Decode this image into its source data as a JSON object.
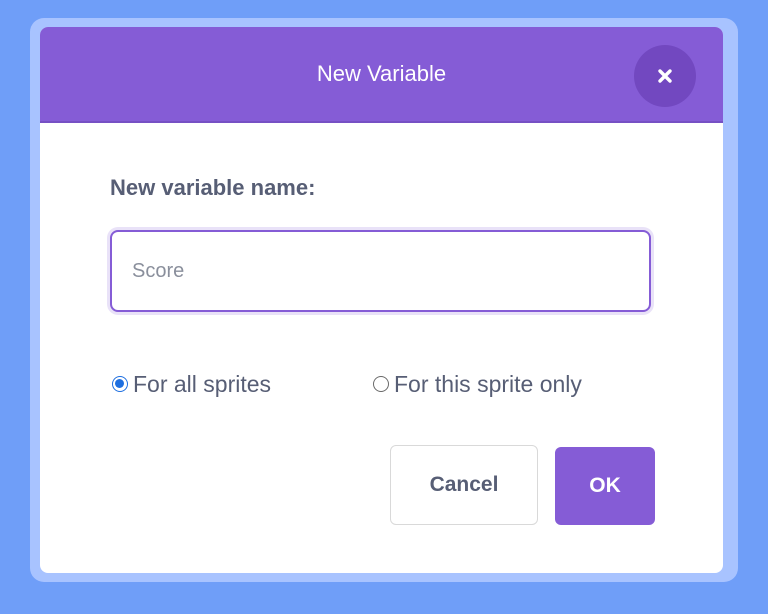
{
  "colors": {
    "background": "#6f9ef8",
    "header": "#855cd6",
    "accent": "#855cd6",
    "radio_selected": "#1e6fe0"
  },
  "dialog": {
    "title": "New Variable",
    "close_icon": "close-icon",
    "field_label": "New variable name:",
    "input": {
      "value": "",
      "placeholder": "Score"
    },
    "scope_options": [
      {
        "label": "For all sprites",
        "selected": true
      },
      {
        "label": "For this sprite only",
        "selected": false
      }
    ],
    "cancel_label": "Cancel",
    "ok_label": "OK"
  }
}
